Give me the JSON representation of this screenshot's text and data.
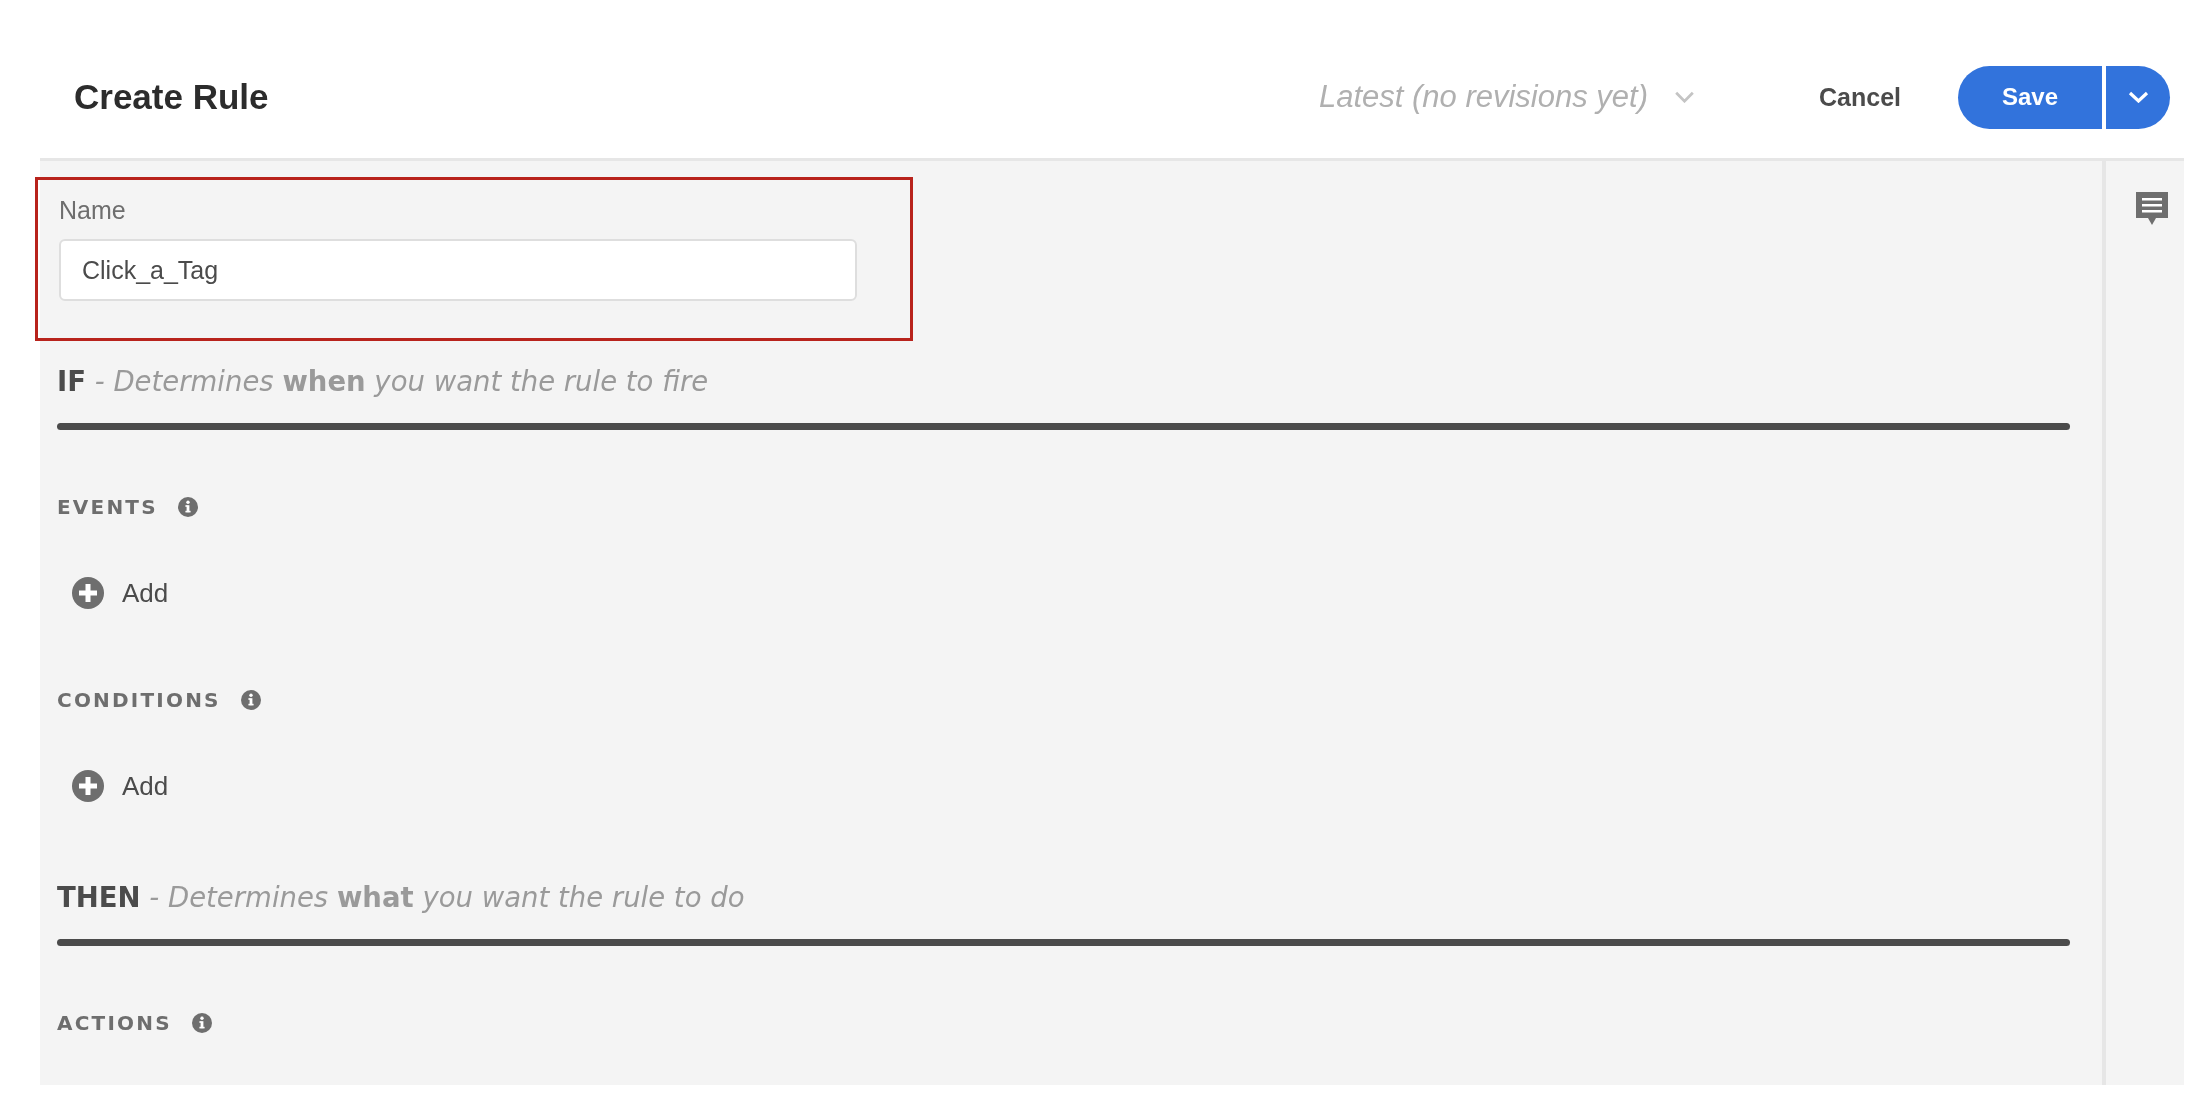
{
  "header": {
    "title": "Create Rule",
    "revision_selector": {
      "label": "Latest (no revisions yet)"
    },
    "cancel_button": {
      "label": "Cancel"
    },
    "save_button": {
      "label": "Save",
      "menu": true
    }
  },
  "name_field": {
    "label": "Name",
    "value": "Click_a_Tag",
    "highlighted": true
  },
  "sections": [
    {
      "keyword": "IF",
      "description": "- Determines **when** you want the rule to fire",
      "groups": [
        {
          "heading": "EVENTS",
          "add_label": "Add"
        },
        {
          "heading": "CONDITIONS",
          "add_label": "Add"
        }
      ]
    },
    {
      "keyword": "THEN",
      "description": "- Determines **what** you want the rule to do",
      "groups": [
        {
          "heading": "ACTIONS"
        }
      ]
    }
  ]
}
